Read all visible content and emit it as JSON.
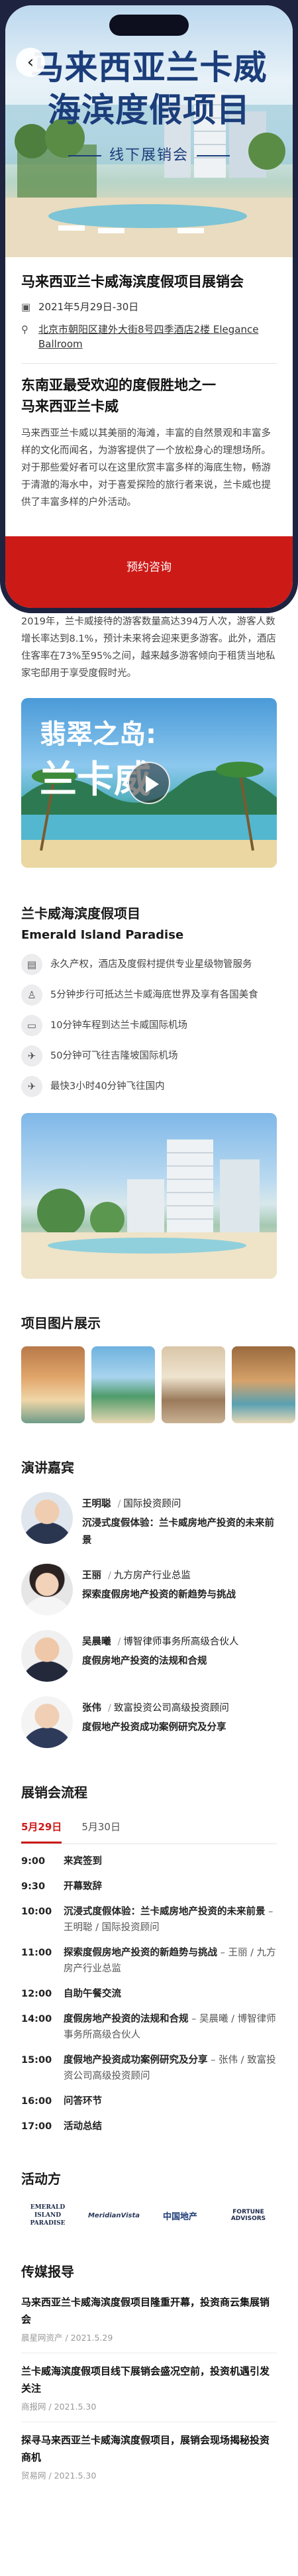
{
  "hero": {
    "title_line1": "马来西亚兰卡威",
    "title_line2": "海滨度假项目",
    "subtitle": "线下展销会"
  },
  "event": {
    "title": "马来西亚兰卡威海滨度假项目展销会",
    "date": "2021年5月29日-30日",
    "address": "北京市朝阳区建外大街8号四季酒店2楼 Elegance Ballroom",
    "intro_heading_line1": "东南亚最受欢迎的度假胜地之一",
    "intro_heading_line2": "马来西亚兰卡威",
    "intro_para": "马来西亚兰卡威以其美丽的海滩，丰富的自然景观和丰富多样的文化而闻名，为游客提供了一个放松身心的理想场所。对于那些爱好者可以在这里欣赏丰富多样的海底生物，畅游于清澈的海水中，对于喜爱探险的旅行者来说，兰卡威也提供了丰富多样的户外活动。",
    "cta": "预约咨询"
  },
  "stats_para": "2019年，兰卡威接待的游客数量高达394万人次，游客人数增长率达到8.1%，预计未来将会迎来更多游客。此外，酒店住客率在73%至95%之间，越来越多游客倾向于租赁当地私家宅邸用于享受度假时光。",
  "video": {
    "title1": "翡翠之岛:",
    "title2": "兰卡威"
  },
  "project": {
    "title_cn": "兰卡威海滨度假项目",
    "title_en": "Emerald Island Paradise",
    "features": [
      {
        "icon": "building-icon",
        "glyph": "▤",
        "text": "永久产权，酒店及度假村提供专业星级物管服务"
      },
      {
        "icon": "walking-icon",
        "glyph": "♙",
        "text": "5分钟步行可抵达兰卡威海底世界及享有各国美食"
      },
      {
        "icon": "car-icon",
        "glyph": "▭",
        "text": "10分钟车程到达兰卡威国际机场"
      },
      {
        "icon": "plane-icon",
        "glyph": "✈",
        "text": "50分钟可飞往吉隆坡国际机场"
      },
      {
        "icon": "plane-icon",
        "glyph": "✈",
        "text": "最快3小时40分钟飞往国内"
      }
    ]
  },
  "gallery": {
    "heading": "项目图片展示"
  },
  "speakers": {
    "heading": "演讲嘉宾",
    "list": [
      {
        "name": "王明聪",
        "role": "国际投资顾问",
        "topic": "沉浸式度假体验：兰卡威房地产投资的未来前景"
      },
      {
        "name": "王丽",
        "role": "九方房产行业总监",
        "topic": "探索度假房地产投资的新趋势与挑战"
      },
      {
        "name": "吴晨曦",
        "role": "博智律师事务所高级合伙人",
        "topic": "度假房地产投资的法规和合规"
      },
      {
        "name": "张伟",
        "role": "致富投资公司高级投资顾问",
        "topic": "度假地产投资成功案例研究及分享"
      }
    ]
  },
  "schedule": {
    "heading": "展销会流程",
    "tabs": [
      "5月29日",
      "5月30日"
    ],
    "items": [
      {
        "time": "9:00",
        "title": "来宾签到",
        "speaker": ""
      },
      {
        "time": "9:30",
        "title": "开幕致辞",
        "speaker": ""
      },
      {
        "time": "10:00",
        "title": "沉浸式度假体验：兰卡威房地产投资的未来前景",
        "speaker": " – 王明聪 / 国际投资顾问"
      },
      {
        "time": "11:00",
        "title": "探索度假房地产投资的新趋势与挑战",
        "speaker": " – 王丽 / 九方房产行业总监"
      },
      {
        "time": "12:00",
        "title": "自助午餐交流",
        "speaker": ""
      },
      {
        "time": "14:00",
        "title": "度假房地产投资的法规和合规",
        "speaker": " – 吴晨曦 / 博智律师事务所高级合伙人"
      },
      {
        "time": "15:00",
        "title": "度假地产投资成功案例研究及分享",
        "speaker": " – 张伟 / 致富投资公司高级投资顾问"
      },
      {
        "time": "16:00",
        "title": "问答环节",
        "speaker": ""
      },
      {
        "time": "17:00",
        "title": "活动总结",
        "speaker": ""
      }
    ]
  },
  "sponsors": {
    "heading": "活动方",
    "list": [
      "EMERALD ISLAND PARADISE",
      "MeridianVista",
      "中国地产",
      "FORTUNE ADVISORS"
    ]
  },
  "news": {
    "heading": "传媒报导",
    "list": [
      {
        "title": "马来西亚兰卡威海滨度假项目隆重开幕，投资商云集展销会",
        "meta": "晨星网资产 / 2021.5.29"
      },
      {
        "title": "兰卡威海滨度假项目线下展销会盛况空前，投资机遇引发关注",
        "meta": "商报网 / 2021.5.30"
      },
      {
        "title": "探寻马来西亚兰卡威海滨度假项目，展销会现场揭秘投资商机",
        "meta": "贸易网 / 2021.5.30"
      }
    ]
  }
}
